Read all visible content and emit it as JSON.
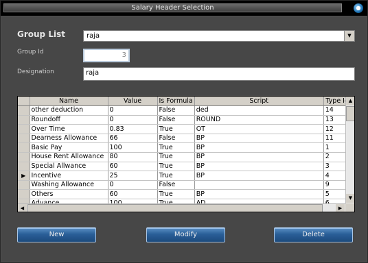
{
  "window": {
    "title": "Salary Header Selection"
  },
  "form": {
    "group_list_label": "Group List",
    "group_list_value": "raja",
    "group_id_label": "Group Id",
    "group_id_value": "3",
    "designation_label": "Designation",
    "designation_value": "raja"
  },
  "grid": {
    "columns": [
      "Name",
      "Value",
      "Is Formula",
      "Script",
      "Type Id"
    ],
    "current_row_index": 7,
    "rows": [
      [
        "other deduction",
        "0",
        "False",
        "ded",
        "14"
      ],
      [
        "Roundoff",
        "0",
        "False",
        "ROUND",
        "13"
      ],
      [
        "Over Time",
        "0.83",
        "True",
        "OT",
        "12"
      ],
      [
        "Dearness Allowance",
        "66",
        "False",
        "BP",
        "11"
      ],
      [
        "Basic Pay",
        "100",
        "True",
        "BP",
        "1"
      ],
      [
        "House Rent Allowance",
        "80",
        "True",
        "BP",
        "2"
      ],
      [
        "Special Allwance",
        "60",
        "True",
        "BP",
        "3"
      ],
      [
        "Incentive",
        "25",
        "True",
        "BP",
        "4"
      ],
      [
        "Washing Allowance",
        "0",
        "False",
        "",
        "9"
      ],
      [
        "Others",
        "60",
        "True",
        "BP",
        "5"
      ],
      [
        "Advance",
        "100",
        "True",
        "AD",
        "6"
      ]
    ]
  },
  "buttons": {
    "new": "New",
    "modify": "Modify",
    "delete": "Delete"
  }
}
